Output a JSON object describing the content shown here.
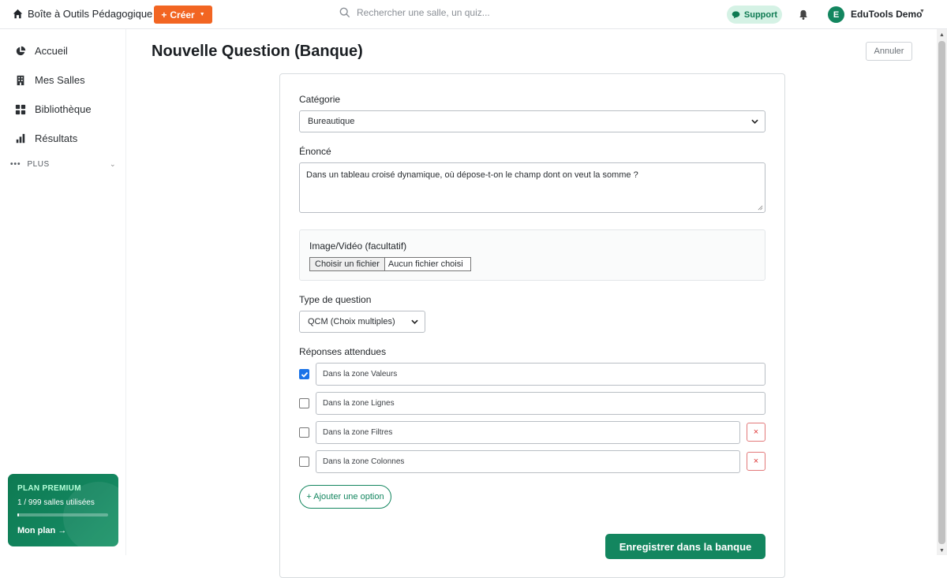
{
  "topbar": {
    "brand": "Boîte à Outils Pédagogique",
    "create_label": "Créer",
    "search_placeholder": "Rechercher une salle, un quiz...",
    "support_label": "Support",
    "user_initial": "E",
    "user_name": "EduTools Demo"
  },
  "sidebar": {
    "items": [
      {
        "label": "Accueil",
        "icon": "pie-chart-icon"
      },
      {
        "label": "Mes Salles",
        "icon": "building-icon"
      },
      {
        "label": "Bibliothèque",
        "icon": "grid-icon"
      },
      {
        "label": "Résultats",
        "icon": "bar-chart-icon"
      }
    ],
    "more_label": "PLUS",
    "plan": {
      "title": "PLAN PREMIUM",
      "usage": "1 / 999 salles utilisées",
      "usage_fraction": 0.001,
      "link": "Mon plan →"
    }
  },
  "main": {
    "title": "Nouvelle Question (Banque)",
    "cancel_label": "Annuler",
    "category_label": "Catégorie",
    "category_value": "Bureautique",
    "statement_label": "Énoncé",
    "statement_value": "Dans un tableau croisé dynamique, où dépose-t-on le champ dont on veut la somme ?",
    "media_label": "Image/Vidéo (facultatif)",
    "file_button": "Choisir un fichier",
    "file_status": "Aucun fichier choisi",
    "type_label": "Type de question",
    "type_value": "QCM (Choix multiples)",
    "answers_label": "Réponses attendues",
    "options": [
      {
        "text": "Dans la zone Valeurs",
        "checked": true,
        "deletable": false
      },
      {
        "text": "Dans la zone Lignes",
        "checked": false,
        "deletable": false
      },
      {
        "text": "Dans la zone Filtres",
        "checked": false,
        "deletable": true
      },
      {
        "text": "Dans la zone Colonnes",
        "checked": false,
        "deletable": true
      }
    ],
    "delete_symbol": "×",
    "add_option_label": "+ Ajouter une option",
    "save_label": "Enregistrer dans la banque"
  },
  "colors": {
    "accent_green": "#13865f",
    "create_orange": "#f26522",
    "checkbox_blue": "#1a73e8",
    "delete_red": "#d33333"
  }
}
